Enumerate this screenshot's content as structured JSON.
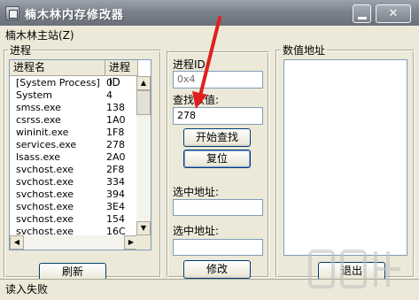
{
  "window": {
    "title": "楠木林内存修改器",
    "minimize_icon": "minimize-icon",
    "close_icon": "close-icon",
    "close_glyph": "✕"
  },
  "menu": {
    "item": "楠木林主站(Z)"
  },
  "process_group": {
    "label": "进程",
    "columns": [
      "进程名",
      "进程ID"
    ],
    "rows": [
      [
        "[System Process]",
        "0"
      ],
      [
        "System",
        "4"
      ],
      [
        "smss.exe",
        "138"
      ],
      [
        "csrss.exe",
        "1A0"
      ],
      [
        "wininit.exe",
        "1F8"
      ],
      [
        "services.exe",
        "278"
      ],
      [
        "lsass.exe",
        "2A0"
      ],
      [
        "svchost.exe",
        "2F8"
      ],
      [
        "svchost.exe",
        "334"
      ],
      [
        "svchost.exe",
        "394"
      ],
      [
        "svchost.exe",
        "3E4"
      ],
      [
        "svchost.exe",
        "154"
      ],
      [
        "svchost.exe",
        "16C"
      ]
    ],
    "refresh_button": "刷新"
  },
  "search_panel": {
    "pid_label": "进程ID:",
    "pid_value": "0x4",
    "search_label": "查找数值:",
    "search_value": "278",
    "start_search_button": "开始查找",
    "reset_button": "复位",
    "selected_addr_label_1": "选中地址:",
    "selected_addr_value_1": "",
    "selected_addr_label_2": "选中地址:",
    "selected_addr_value_2": "",
    "modify_button": "修改"
  },
  "address_group": {
    "label": "数值地址",
    "exit_button": "退出"
  },
  "status": {
    "text": "读入失败"
  },
  "colors": {
    "title_bar": "#7d838d",
    "arrow": "#e02020",
    "panel": "#ece9d8"
  }
}
